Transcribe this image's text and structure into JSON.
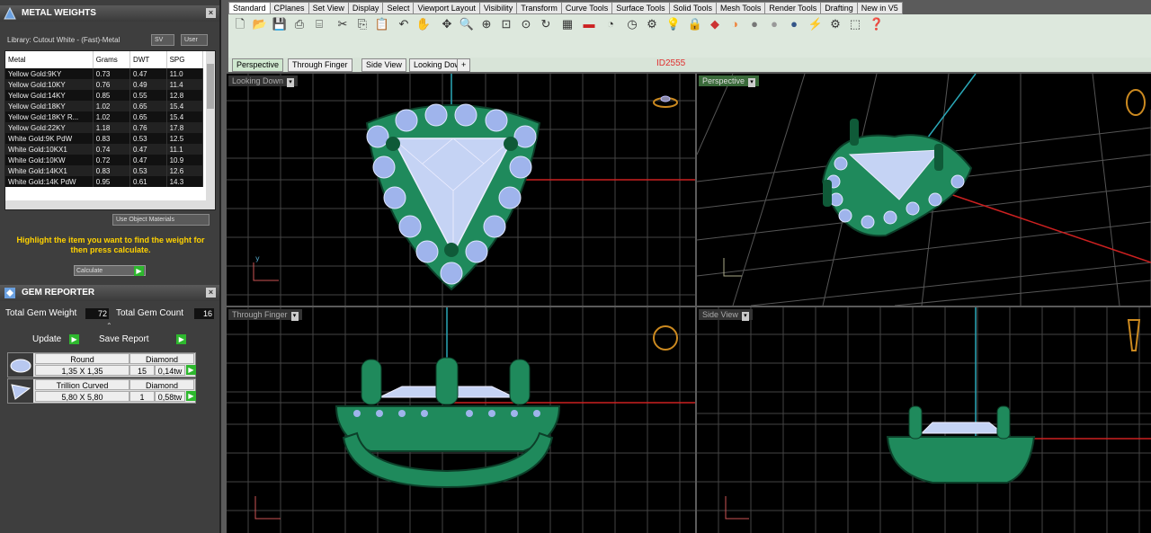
{
  "metal_panel": {
    "title": "METAL WEIGHTS",
    "library": "Library: Cutout White - (Fast)-Metal",
    "btn_sv": "SV",
    "btn_user": "User",
    "columns": [
      "Metal",
      "Grams",
      "DWT",
      "SPG"
    ],
    "rows": [
      [
        "Yellow Gold:9KY",
        "0.73",
        "0.47",
        "11.0"
      ],
      [
        "Yellow Gold:10KY",
        "0.76",
        "0.49",
        "11.4"
      ],
      [
        "Yellow Gold:14KY",
        "0.85",
        "0.55",
        "12.8"
      ],
      [
        "Yellow Gold:18KY",
        "1.02",
        "0.65",
        "15.4"
      ],
      [
        "Yellow Gold:18KY R...",
        "1.02",
        "0.65",
        "15.4"
      ],
      [
        "Yellow Gold:22KY",
        "1.18",
        "0.76",
        "17.8"
      ],
      [
        "White Gold:9K PdW",
        "0.83",
        "0.53",
        "12.5"
      ],
      [
        "White Gold:10KX1",
        "0.74",
        "0.47",
        "11.1"
      ],
      [
        "White Gold:10KW",
        "0.72",
        "0.47",
        "10.9"
      ],
      [
        "White Gold:14KX1",
        "0.83",
        "0.53",
        "12.6"
      ],
      [
        "White Gold:14K PdW",
        "0.95",
        "0.61",
        "14.3"
      ]
    ],
    "use_object_materials": "Use Object Materials",
    "hint": "Highlight the item you want to find the weight for then press calculate.",
    "calculate": "Calculate"
  },
  "gem_panel": {
    "title": "GEM REPORTER",
    "total_weight_label": "Total Gem Weight",
    "total_weight": "72",
    "total_count_label": "Total Gem Count",
    "total_count": "16",
    "update": "Update",
    "save_report": "Save Report",
    "gems": [
      {
        "shape": "Round",
        "material": "Diamond",
        "size": "1,35 X 1,35",
        "count": "15",
        "weight": "0,14tw"
      },
      {
        "shape": "Trillion Curved",
        "material": "Diamond",
        "size": "5,80 X 5,80",
        "count": "1",
        "weight": "0,58tw"
      }
    ]
  },
  "toolbar_tabs": [
    "Standard",
    "CPlanes",
    "Set View",
    "Display",
    "Select",
    "Viewport Layout",
    "Visibility",
    "Transform",
    "Curve Tools",
    "Surface Tools",
    "Solid Tools",
    "Mesh Tools",
    "Render Tools",
    "Drafting",
    "New in V5"
  ],
  "view_tabs": [
    "Perspective",
    "Through Finger",
    "Side View",
    "Looking Down",
    "+"
  ],
  "id_label": "ID2555",
  "viewports": {
    "top_left": "Looking Down",
    "top_right": "Perspective",
    "bottom_left": "Through Finger",
    "bottom_right": "Side View"
  },
  "colors": {
    "metal": "#1f8a5c",
    "gem": "#b8c8f0",
    "axis_red": "#cc2020",
    "axis_teal": "#2aa8b8",
    "grid": "#555555"
  }
}
